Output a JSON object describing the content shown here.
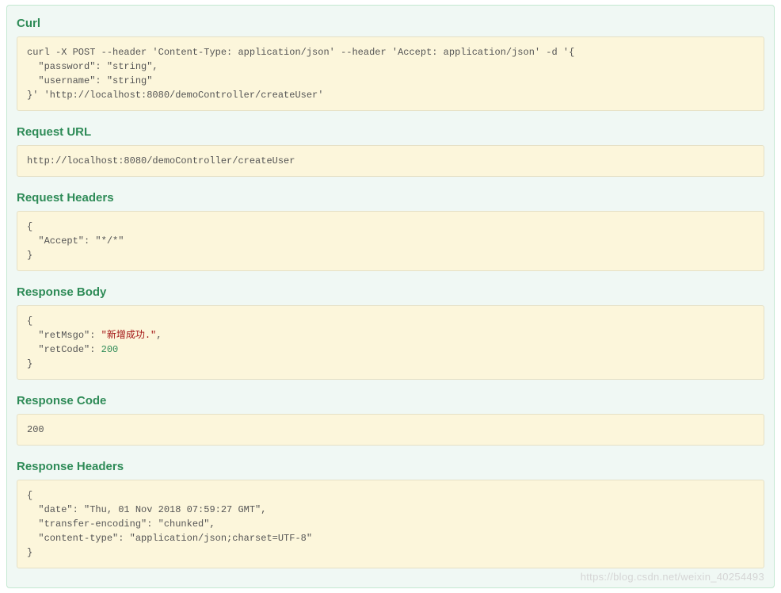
{
  "sections": {
    "curl": {
      "title": "Curl",
      "content": "curl -X POST --header 'Content-Type: application/json' --header 'Accept: application/json' -d '{\n  \"password\": \"string\",\n  \"username\": \"string\"\n}' 'http://localhost:8080/demoController/createUser'"
    },
    "request_url": {
      "title": "Request URL",
      "content": "http://localhost:8080/demoController/createUser"
    },
    "request_headers": {
      "title": "Request Headers",
      "content": "{\n  \"Accept\": \"*/*\"\n}"
    },
    "response_body": {
      "title": "Response Body",
      "retMsgo_key": "\"retMsgo\"",
      "retMsgo_val": "\"新增成功.\"",
      "retCode_key": "\"retCode\"",
      "retCode_val": "200"
    },
    "response_code": {
      "title": "Response Code",
      "content": "200"
    },
    "response_headers": {
      "title": "Response Headers",
      "content": "{\n  \"date\": \"Thu, 01 Nov 2018 07:59:27 GMT\",\n  \"transfer-encoding\": \"chunked\",\n  \"content-type\": \"application/json;charset=UTF-8\"\n}"
    }
  },
  "watermark": "https://blog.csdn.net/weixin_40254493"
}
